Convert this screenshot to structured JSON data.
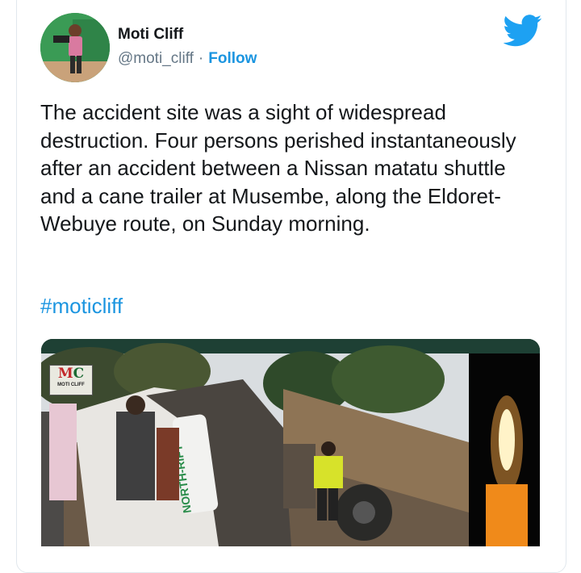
{
  "author": {
    "name": "Moti Cliff",
    "handle": "@moti_cliff",
    "separator": "·",
    "follow_label": "Follow"
  },
  "tweet": {
    "text": "The accident site was a sight of widespread destruction. Four persons perished instantaneously after an accident between a Nissan matatu shuttle and a cane trailer at Musembe, along the Eldoret-Webuye route, on Sunday morning.",
    "hashtag": "#moticliff"
  },
  "media": {
    "logo_text_m": "M",
    "logo_text_c": "C",
    "logo_subtext": "MOTI CLIFF",
    "sack_text": "NORTH-RIFT"
  },
  "colors": {
    "link": "#1b95e0",
    "twitter_blue": "#1da1f2",
    "text": "#14171a",
    "secondary": "#657786"
  },
  "icons": [
    "twitter-bird-icon"
  ]
}
